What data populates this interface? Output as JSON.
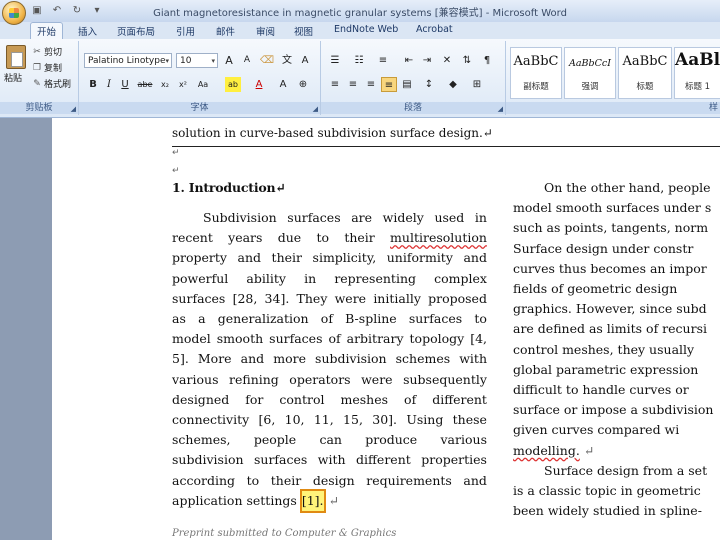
{
  "window": {
    "title": "Giant magnetoresistance in magnetic granular systems [兼容模式] - Microsoft Word"
  },
  "ribbon": {
    "tabs": [
      {
        "label": "开始",
        "active": true
      },
      {
        "label": "插入"
      },
      {
        "label": "页面布局"
      },
      {
        "label": "引用"
      },
      {
        "label": "邮件"
      },
      {
        "label": "审阅"
      },
      {
        "label": "视图"
      },
      {
        "label": "EndNote Web"
      },
      {
        "label": "Acrobat"
      }
    ],
    "clipboard": {
      "paste": "粘贴",
      "cut": "剪切",
      "copy": "复制",
      "format_painter": "格式刷",
      "group_label": "剪贴板"
    },
    "font": {
      "family": "Palatino Linotype",
      "size": "10",
      "grow": "A",
      "shrink": "A",
      "bold": "B",
      "italic": "I",
      "underline": "U",
      "strike": "abe",
      "subscript": "x₂",
      "superscript": "x²",
      "case": "Aa",
      "highlight": "ab",
      "font_color": "A",
      "group_label": "字体"
    },
    "paragraph": {
      "group_label": "段落"
    },
    "styles": [
      {
        "sample": "AaBbC",
        "name": "副标题"
      },
      {
        "sample": "AaBbCcI",
        "name": "强调"
      },
      {
        "sample": "AaBbC",
        "name": "标题"
      },
      {
        "sample": "AaBl",
        "name": "标题 1"
      }
    ],
    "styles_group_label": "样"
  },
  "document": {
    "header_line": "solution in curve-based subdivision surface design.↵",
    "heading": "1. Introduction↵",
    "left_column": [
      [
        "Subdivision",
        "surfaces",
        "are",
        "widely",
        "used",
        "in"
      ],
      [
        "recent",
        "years",
        "due",
        "to",
        "their",
        "multiresolution"
      ],
      [
        "property",
        "and",
        "their",
        "simplicity,",
        "uniformity",
        "and"
      ],
      [
        "powerful",
        "ability",
        "in",
        "representing",
        "complex"
      ],
      [
        "surfaces",
        "[28,",
        "34].",
        "They",
        "were",
        "initially",
        "proposed"
      ],
      [
        "as",
        "a",
        "generalization",
        "of",
        "B-spline",
        "surfaces",
        "to"
      ],
      [
        "model",
        "smooth",
        "surfaces",
        "of",
        "arbitrary",
        "topology",
        "[4,"
      ],
      [
        "5].",
        "More",
        "and",
        "more",
        "subdivision",
        "schemes",
        "with"
      ],
      [
        "various",
        "refining",
        "operators",
        "were",
        "subsequently"
      ],
      [
        "designed",
        "for",
        "control",
        "meshes",
        "of",
        "different"
      ],
      [
        "connectivity",
        "[6,",
        "10,",
        "11,",
        "15,",
        "30].",
        "Using",
        "these"
      ],
      [
        "schemes,",
        "people",
        "can",
        "produce",
        "various"
      ],
      [
        "subdivision",
        "surfaces",
        "with",
        "different",
        "properties"
      ],
      [
        "according",
        "to",
        "their",
        "design",
        "requirements",
        "and"
      ]
    ],
    "left_last_line": {
      "before": "application settings",
      "highlight": "[1].",
      "after": "↵"
    },
    "right_column": [
      "On the other hand, people",
      "model smooth surfaces under s",
      "such as points, tangents, norm",
      "Surface design under constr",
      "curves thus becomes an impor",
      "fields of geometric design",
      "graphics. However, since subd",
      "are defined as limits of recursi",
      "control meshes, they usually",
      "global parametric expression",
      "difficult to handle curves or",
      "surface or impose a subdivision",
      "given curves compared wi",
      "modelling. ↵",
      "Surface design from a set",
      "is a classic topic in geometric",
      "been widely studied in spline-"
    ],
    "footer": "Preprint submitted to Computer & Graphics"
  }
}
